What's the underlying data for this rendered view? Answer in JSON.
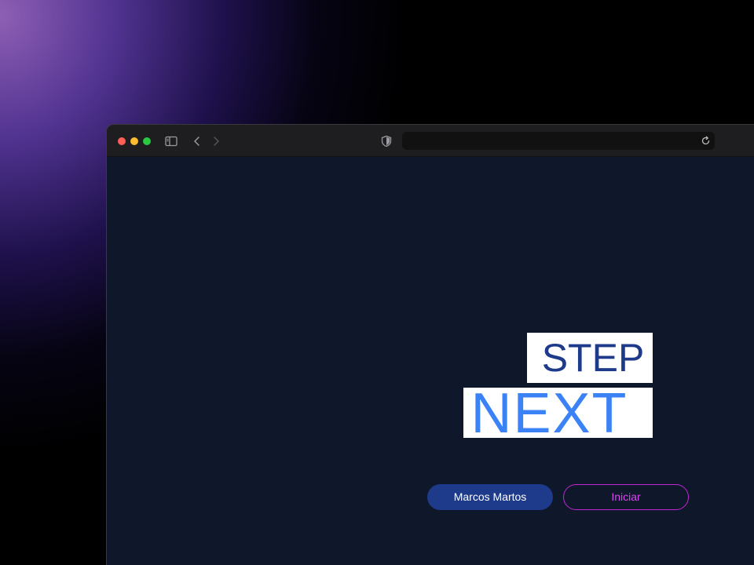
{
  "browser": {
    "toolbar_icons": [
      "sidebar-icon",
      "chevron-left-icon",
      "chevron-right-icon",
      "shield-icon",
      "reload-icon"
    ],
    "address_value": ""
  },
  "page": {
    "logo": {
      "line1": "STEP",
      "line2": "NEXT"
    },
    "user_button_label": "Marcos Martos",
    "start_button_label": "Iniciar"
  },
  "colors": {
    "page_background": "#0f172a",
    "logo_step": "#1e3a8a",
    "logo_next": "#3b82f6",
    "user_button": "#1e3a8a",
    "start_button_accent": "#d946ef"
  }
}
